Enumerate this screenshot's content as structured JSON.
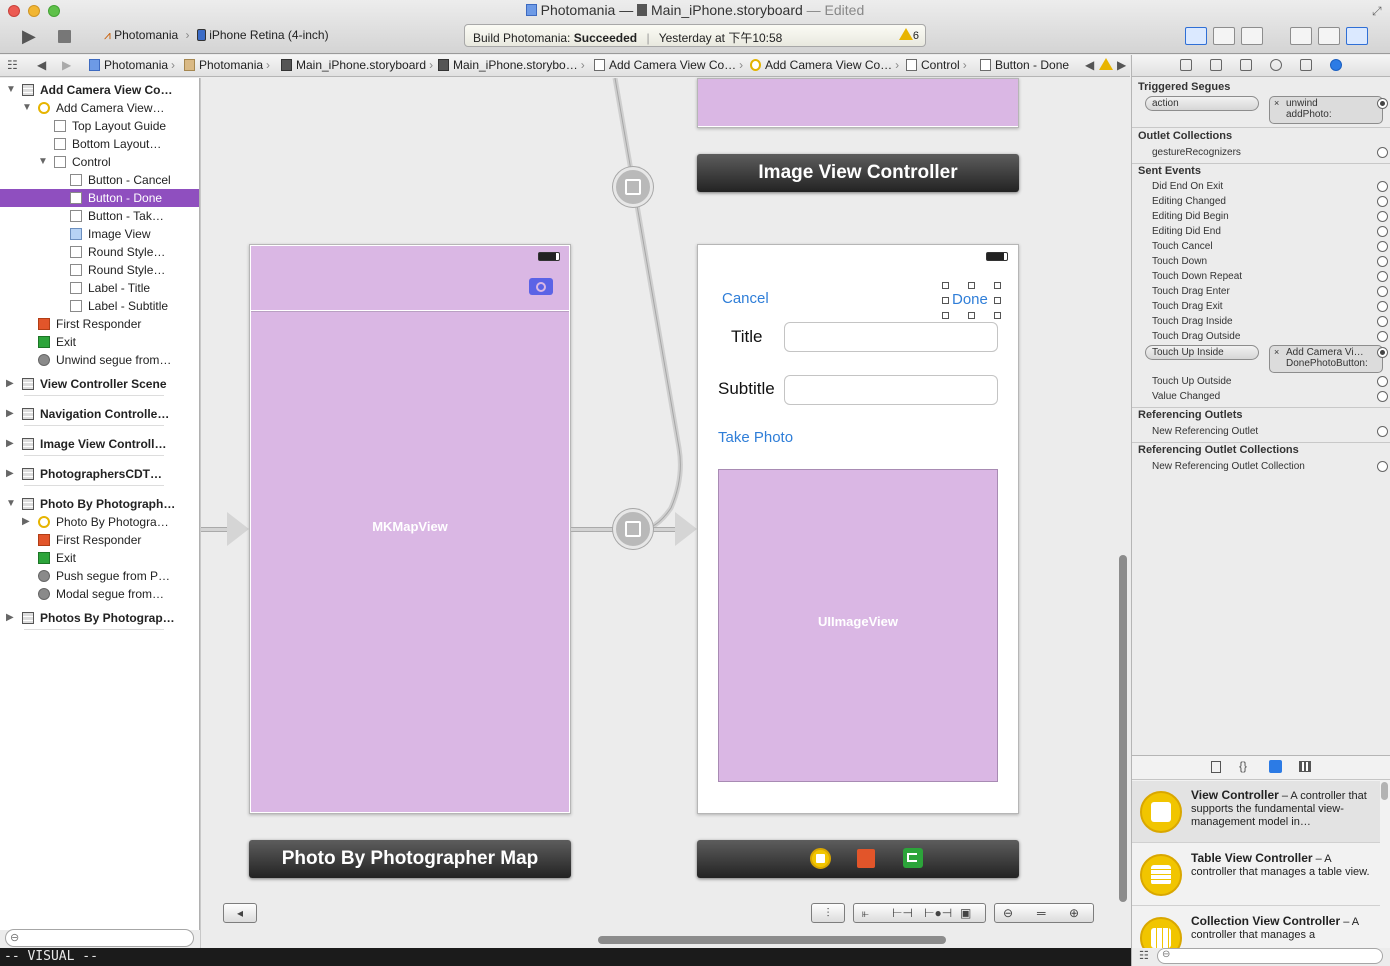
{
  "window": {
    "title_app": "Photomania",
    "title_sep": "—",
    "title_file": "Main_iPhone.storyboard",
    "title_edited": "— Edited"
  },
  "toolbar": {
    "scheme": "Photomania",
    "destination": "iPhone Retina (4-inch)",
    "activity_prefix": "Build Photomania:",
    "activity_status": "Succeeded",
    "activity_time": "Yesterday at 下午10:58",
    "warning_count": "6"
  },
  "jumpbar": {
    "crumbs": [
      "Photomania",
      "Photomania",
      "Main_iPhone.storyboard",
      "Main_iPhone.storybo…",
      "Add Camera View Co…",
      "Add Camera View Co…",
      "Control",
      "Button - Done"
    ]
  },
  "outline": {
    "rows": [
      {
        "label": "Add Camera View Co…",
        "level": 0,
        "icon": "scene",
        "bold": true,
        "open": true
      },
      {
        "label": "Add Camera View…",
        "level": 1,
        "icon": "vc",
        "open": true
      },
      {
        "label": "Top Layout Guide",
        "level": 2,
        "icon": "lay"
      },
      {
        "label": "Bottom Layout…",
        "level": 2,
        "icon": "lay"
      },
      {
        "label": "Control",
        "level": 2,
        "icon": "lay",
        "open": true
      },
      {
        "label": "Button - Cancel",
        "level": 3,
        "icon": "lay"
      },
      {
        "label": "Button - Done",
        "level": 3,
        "icon": "lay",
        "selected": true
      },
      {
        "label": "Button - Tak…",
        "level": 3,
        "icon": "lay"
      },
      {
        "label": "Image View",
        "level": 3,
        "icon": "img"
      },
      {
        "label": "Round Style…",
        "level": 3,
        "icon": "lay"
      },
      {
        "label": "Round Style…",
        "level": 3,
        "icon": "lay"
      },
      {
        "label": "Label - Title",
        "level": 3,
        "icon": "lay"
      },
      {
        "label": "Label - Subtitle",
        "level": 3,
        "icon": "lay"
      },
      {
        "label": "First Responder",
        "level": 1,
        "icon": "cube"
      },
      {
        "label": "Exit",
        "level": 1,
        "icon": "exit"
      },
      {
        "label": "Unwind segue from…",
        "level": 1,
        "icon": "segue"
      },
      {
        "label": "View Controller Scene",
        "level": 0,
        "icon": "scene",
        "bold": true
      },
      {
        "label": "Navigation Controlle…",
        "level": 0,
        "icon": "scene",
        "bold": true
      },
      {
        "label": "Image View Controll…",
        "level": 0,
        "icon": "scene",
        "bold": true
      },
      {
        "label": "PhotographersCDT…",
        "level": 0,
        "icon": "scene",
        "bold": true
      },
      {
        "label": "Photo By Photograph…",
        "level": 0,
        "icon": "scene",
        "bold": true,
        "open": true
      },
      {
        "label": "Photo By Photogra…",
        "level": 1,
        "icon": "vc",
        "closed": true
      },
      {
        "label": "First Responder",
        "level": 1,
        "icon": "cube"
      },
      {
        "label": "Exit",
        "level": 1,
        "icon": "exit"
      },
      {
        "label": "Push segue from P…",
        "level": 1,
        "icon": "segue"
      },
      {
        "label": "Modal segue from…",
        "level": 1,
        "icon": "segue"
      },
      {
        "label": "Photos By Photograp…",
        "level": 0,
        "icon": "scene",
        "bold": true
      }
    ]
  },
  "canvas": {
    "image_vc_title": "Image View Controller",
    "map_title": "Photo By Photographer Map",
    "map_view_label": "MKMapView",
    "add_camera": {
      "cancel": "Cancel",
      "done": "Done",
      "title_label": "Title",
      "subtitle_label": "Subtitle",
      "take_photo": "Take Photo",
      "image_view_label": "UIImageView"
    }
  },
  "inspector": {
    "triggered_segues": "Triggered Segues",
    "action": "action",
    "unwind_target": "unwind",
    "unwind_method": "addPhoto:",
    "outlet_collections": "Outlet Collections",
    "gesture": "gestureRecognizers",
    "sent_events": "Sent Events",
    "events": [
      "Did End On Exit",
      "Editing Changed",
      "Editing Did Begin",
      "Editing Did End",
      "Touch Cancel",
      "Touch Down",
      "Touch Down Repeat",
      "Touch Drag Enter",
      "Touch Drag Exit",
      "Touch Drag Inside",
      "Touch Drag Outside"
    ],
    "touch_up_inside": "Touch Up Inside",
    "tui_target": "Add Camera Vi…",
    "tui_method": "DonePhotoButton:",
    "events_after": [
      "Touch Up Outside",
      "Value Changed"
    ],
    "referencing_outlets": "Referencing Outlets",
    "new_ref_outlet": "New Referencing Outlet",
    "referencing_outlet_collections": "Referencing Outlet Collections",
    "new_ref_outlet_collection": "New Referencing Outlet Collection"
  },
  "library": {
    "items": [
      {
        "title": "View Controller",
        "desc": " – A controller that supports the fundamental view-management model in…"
      },
      {
        "title": "Table View Controller",
        "desc": " – A controller that manages a table view."
      },
      {
        "title": "Collection View Controller",
        "desc": " – A controller that manages a"
      }
    ]
  },
  "vim": {
    "mode": "-- VISUAL --"
  },
  "colors": {
    "selection": "#8f4fbf",
    "violet_fill": "#dab7e4",
    "ios_blue": "#2f7ed8"
  }
}
